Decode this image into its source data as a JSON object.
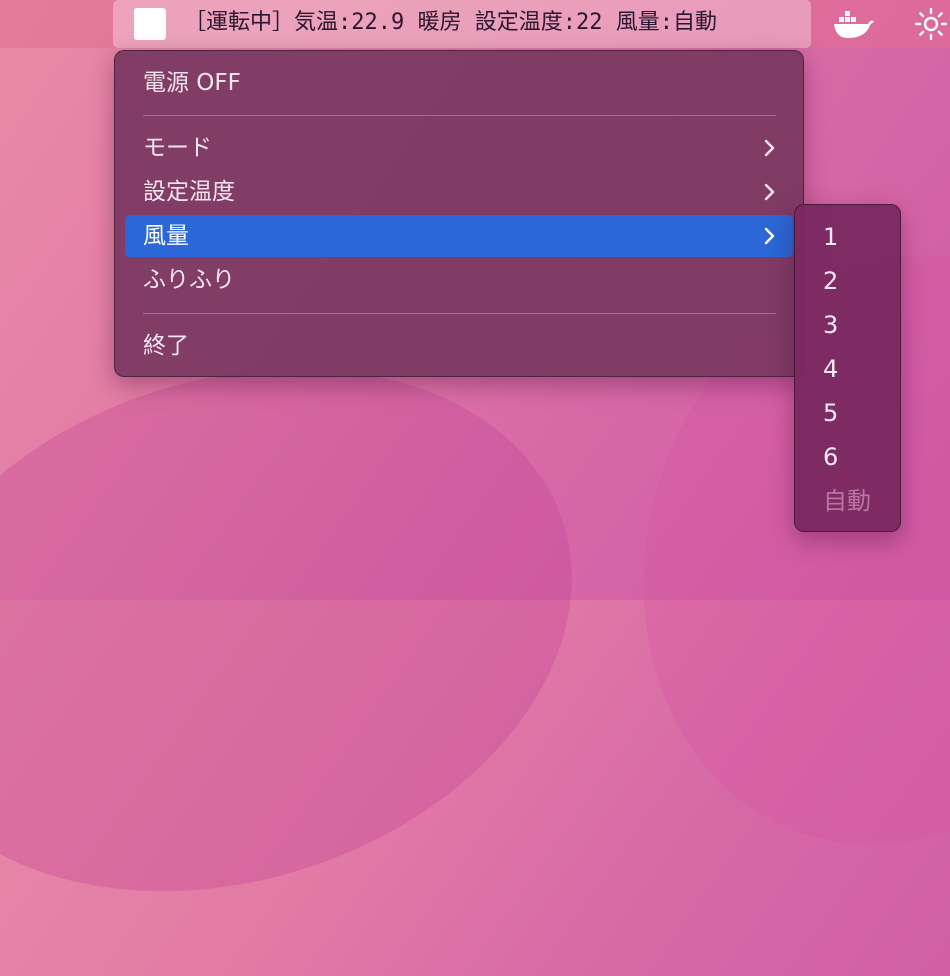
{
  "menubar": {
    "status_text": "［運転中］気温:22.9 暖房 設定温度:22 風量:自動",
    "icons": [
      "app-status-square",
      "docker-icon",
      "brightness-icon"
    ]
  },
  "menu": {
    "items": [
      {
        "label": "電源 OFF",
        "has_submenu": false
      },
      {
        "label": "モード",
        "has_submenu": true
      },
      {
        "label": "設定温度",
        "has_submenu": true
      },
      {
        "label": "風量",
        "has_submenu": true,
        "highlighted": true
      },
      {
        "label": "ふりふり",
        "has_submenu": false
      },
      {
        "label": "終了",
        "has_submenu": false
      }
    ]
  },
  "submenu": {
    "items": [
      {
        "label": "1"
      },
      {
        "label": "2"
      },
      {
        "label": "3"
      },
      {
        "label": "4"
      },
      {
        "label": "5"
      },
      {
        "label": "6"
      },
      {
        "label": "自動",
        "disabled": true
      }
    ]
  },
  "colors": {
    "highlight": "#2b67d6",
    "menu_bg": "#78375f",
    "submenu_bg": "#7a2860"
  }
}
